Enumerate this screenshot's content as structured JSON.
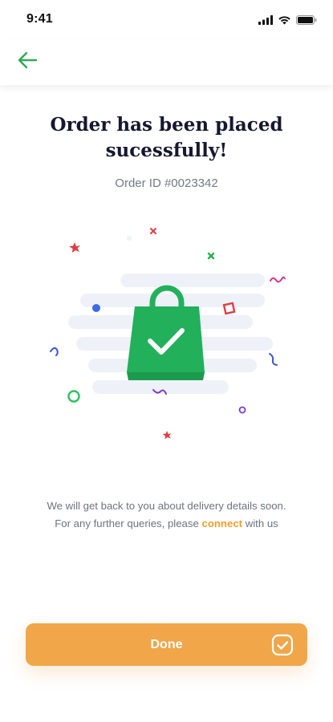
{
  "status_bar": {
    "time": "9:41",
    "icons": [
      "signal-icon",
      "wifi-icon",
      "battery-icon"
    ]
  },
  "header": {
    "back_icon": "arrow-left-icon",
    "accent_color": "#2eaa57"
  },
  "main": {
    "title_line1": "Order has been placed",
    "title_line2": "sucessfully!",
    "order_id": "Order ID #0023342",
    "illustration_icon": "shopping-bag-check-icon",
    "info_line1": "We will get back to you about delivery details soon.",
    "info_line2_prefix": "For any further queries, please ",
    "info_link": "connect",
    "info_line2_suffix": " with us"
  },
  "footer": {
    "done_label": "Done",
    "done_icon": "checkbox-check-icon",
    "button_color": "#f0a649"
  },
  "colors": {
    "bag_green": "#22b05a",
    "title": "#161730",
    "muted_text": "#6d7380",
    "link": "#f0a02e"
  }
}
